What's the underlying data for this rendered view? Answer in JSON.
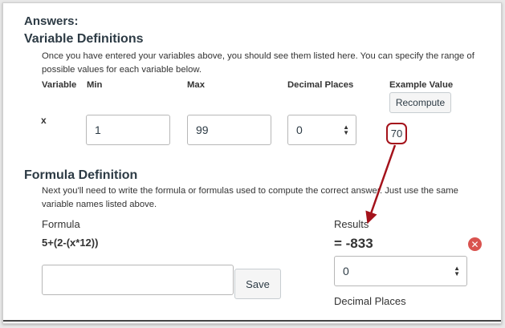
{
  "answers_heading": "Answers:",
  "variable_definitions": {
    "heading": "Variable Definitions",
    "description": "Once you have entered your variables above, you should see them listed here. You can specify the range of possible values for each variable below.",
    "columns": {
      "variable": "Variable",
      "min": "Min",
      "max": "Max",
      "decimal_places": "Decimal Places",
      "example_value": "Example Value"
    },
    "recompute_label": "Recompute",
    "row": {
      "variable": "x",
      "min": "1",
      "max": "99",
      "decimal_places": "0",
      "example_value": "70"
    }
  },
  "formula_definition": {
    "heading": "Formula Definition",
    "description": "Next you'll need to write the formula or formulas used to compute the correct answer. Just use the same variable names listed above.",
    "formula_label": "Formula",
    "formula_text": "5+(2-(x*12))",
    "formula_input_value": "",
    "save_label": "Save",
    "results_label": "Results",
    "result_value": "= -833",
    "decimal_places_value": "0",
    "decimal_places_label": "Decimal Places"
  },
  "colors": {
    "annotation": "#a4121b",
    "remove_icon": "#d9534f",
    "text": "#2d3b45"
  }
}
